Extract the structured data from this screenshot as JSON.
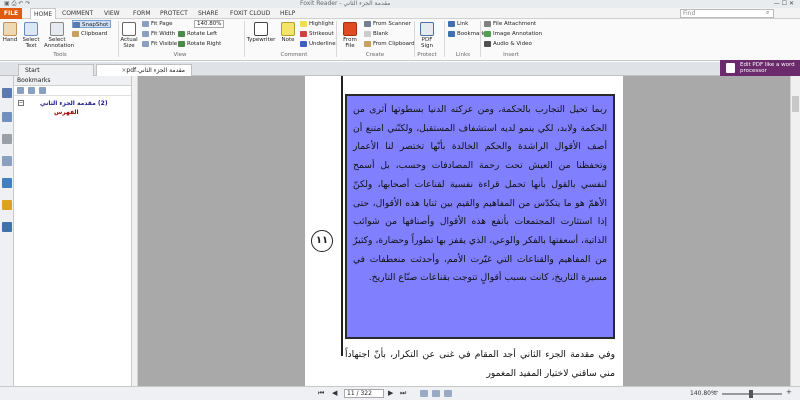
{
  "window": {
    "title": "مقدمة الجزء الثاني - Foxit Reader",
    "controls": "—  ☐  ✕"
  },
  "menu": {
    "file": "FILE",
    "tabs": [
      "HOME",
      "COMMENT",
      "VIEW",
      "FORM",
      "PROTECT",
      "SHARE",
      "FOXIT CLOUD",
      "HELP"
    ],
    "active_tab": "HOME",
    "search_placeholder": "Find"
  },
  "ribbon": {
    "hand": "Hand",
    "select_text": "Select Text",
    "select_annotation": "Select Annotation",
    "snapshot": "SnapShot",
    "clipboard": "Clipboard",
    "actual_size": "Actual Size",
    "fit_page": "Fit Page",
    "fit_width": "Fit Width",
    "fit_visible": "Fit Visible",
    "zoom": "140.80%",
    "rotate_left": "Rotate Left",
    "rotate_right": "Rotate Right",
    "typewriter": "Typewriter",
    "note": "Note",
    "highlight": "Highlight",
    "strikeout": "Strikeout",
    "underline": "Underline",
    "from_file": "From File",
    "from_scanner": "From Scanner",
    "blank": "Blank",
    "from_clipboard": "From Clipboard",
    "pdf_sign": "PDF Sign",
    "link": "Link",
    "bookmark": "Bookmark",
    "file_attachment": "File Attachment",
    "image_annotation": "Image Annotation",
    "audio_video": "Audio & Video",
    "groups": {
      "tools": "Tools",
      "view": "View",
      "comment": "Comment",
      "create": "Create",
      "protect": "Protect",
      "links": "Links",
      "insert": "Insert"
    }
  },
  "promo": {
    "text": "Edit PDF like a word processor"
  },
  "doc_tabs": [
    {
      "label": "Start",
      "active": false
    },
    {
      "label": "مقدمة الجزء الثاني.pdf",
      "active": true
    }
  ],
  "bookmarks": {
    "header": "Bookmarks",
    "root": "(2) مقدمة الجزء الثاني",
    "child": "الفهرس"
  },
  "page": {
    "number": "١١",
    "highlighted_text": "ربما تحيل التجارب بالحكمة، ومن عركته الدنيا بسطوتها آثرى من الحكمة ولابد، لكي ينمو لديه استشفاف المستقبل، ولكنّني امتنع أن أصف الأقوال الراشدة والحكم الخالدة بأنّها تختصر لنا الأعمار وتحفظنا من العيش تحت رحمة المصادفات وحسب، بل أسمح لنفسي بالقول بأنها تحمل قراءة نفسية لقناعات أصحابها، ولكنّ الأهمّ هو ما يتكدّس من المفاهيم والقيم بين ثنايا هذه الأقوال، حتى إذا استثارت المجتمعات بأنفع هذه الأقوال وأصنافها من شوائب الذاتية، أسعفتها بالفكر والوعي، الذي يقفز بها تطوراً وحضارة، وكثيرٌ من المفاهيم والقناعات التي غيّرت الأمم، وأحدثت منعطفات في مسيرة التاريخ، كانت بسبب أقوالٍ تتوجت بقناعات صنّاع التاريخ.",
    "following_text": "وفي مقدمة الجزء الثاني أجد المقام في غنى عن التكرار، بأنّ اجتهاداً مني ساقني لاختيار المفيد المغمور"
  },
  "status": {
    "page_indicator": "11 / 322",
    "zoom": "140.80%",
    "zoom_level_percent": 45
  },
  "colors": {
    "accent": "#e05a10",
    "highlight": "#8080ff",
    "promo": "#6b2a6b",
    "bookmark_root": "#1a1a8a",
    "bookmark_child": "#a00000"
  }
}
